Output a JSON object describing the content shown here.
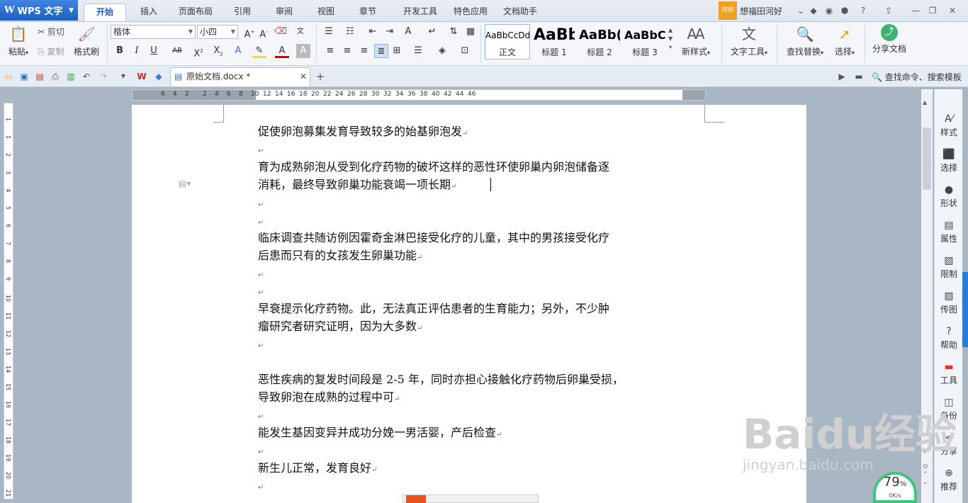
{
  "app": {
    "name": "WPS 文字"
  },
  "tabs": [
    "开始",
    "插入",
    "页面布局",
    "引用",
    "审阅",
    "视图",
    "章节",
    "开发工具",
    "特色应用",
    "文档助手"
  ],
  "user": {
    "badge": "河好",
    "name": "想福田河好"
  },
  "ribbon": {
    "paste": "粘贴",
    "cut": "剪切",
    "copy": "复制",
    "format_painter": "格式刷",
    "font_name": "楷体",
    "font_size": "小四",
    "styles": [
      {
        "preview": "AaBbCcDd",
        "label": "正文"
      },
      {
        "preview": "AaBb",
        "label": "标题 1"
      },
      {
        "preview": "AaBb(",
        "label": "标题 2"
      },
      {
        "preview": "AaBbC",
        "label": "标题 3"
      }
    ],
    "new_style": "新样式",
    "text_tools": "文字工具",
    "find_replace": "查找替换",
    "select": "选择",
    "share_doc": "分享文档"
  },
  "doc_tab": {
    "title": "原始文档.docx *"
  },
  "search_cmd": "查找命令、搜索模板",
  "document": {
    "paragraphs": [
      {
        "lines": [
          "促使卵泡募集发育导致较多的始基卵泡发"
        ]
      },
      {
        "lines": [
          "育为成熟卵泡从受到化疗药物的破坏这样的恶性环使卵巢内卵泡储备逐",
          "消耗，最终导致卵巢功能衰竭一项长期"
        ]
      },
      {
        "lines": [
          "临床调查共随访例因霍奇金淋巴接受化疗的儿童，其中的男孩接受化疗",
          "后患而只有的女孩发生卵巢功能"
        ]
      },
      {
        "lines": [
          "早衰提示化疗药物。此，无法真正评估患者的生育能力；另外，不少肿",
          "瘤研究者研究证明，因为大多数"
        ]
      },
      {
        "lines": [
          "恶性疾病的复发时间段是 2-5 年，同时亦担心接触化疗药物后卵巢受损，",
          "导致卵泡在成熟的过程中可"
        ]
      },
      {
        "lines": [
          "能发生基因变异并成功分娩一男活婴，产后检查"
        ]
      },
      {
        "lines": [
          "新生儿正常，发育良好"
        ]
      }
    ]
  },
  "ruler": {
    "top_ticks": [
      "6",
      "4",
      "2",
      "2",
      "4",
      "6",
      "8",
      "10",
      "12",
      "14",
      "16",
      "18",
      "20",
      "22",
      "24",
      "26",
      "28",
      "30",
      "32",
      "34",
      "36",
      "38",
      "40",
      "42",
      "44",
      "46"
    ],
    "left_ticks": [
      "1",
      "1",
      "2",
      "3",
      "4",
      "5",
      "6",
      "7",
      "8",
      "9",
      "10",
      "11",
      "12",
      "13",
      "14",
      "15",
      "16",
      "17",
      "18",
      "19",
      "20",
      "21"
    ]
  },
  "right_panel": [
    "样式",
    "选择",
    "形状",
    "属性",
    "限制",
    "传图",
    "帮助",
    "工具",
    "备份",
    "分享",
    "推荐"
  ],
  "speed": {
    "percent": "79",
    "unit": "%",
    "rate": "0K/s"
  },
  "watermark": {
    "brand": "Baidu经验",
    "url": "jingyan.baidu.com"
  }
}
